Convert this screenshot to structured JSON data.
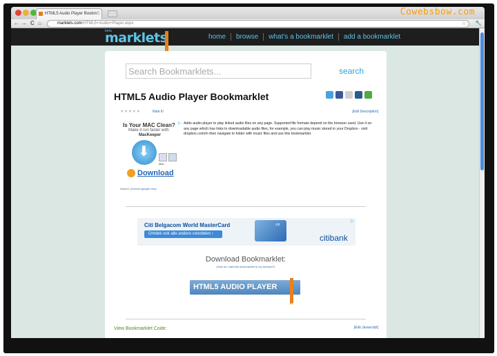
{
  "browser": {
    "tab_title": "HTML5 Audio Player Bookm...",
    "tab_close": "×",
    "url_host": "marklets.com",
    "url_path": "/HTML5+Audio+Player.aspx",
    "back_glyph": "←",
    "forward_glyph": "→",
    "reload_glyph": "C",
    "home_glyph": "⌂",
    "watermark": "Cowebsbow.com",
    "star_glyph": "☆",
    "wrench_glyph": "🔧",
    "icons": [
      "back-icon",
      "forward-icon",
      "reload-icon",
      "home-icon",
      "bookmark-star-icon",
      "wrench-icon"
    ]
  },
  "site": {
    "logo": "marklets",
    "logo_beta": "beta",
    "nav": [
      "home",
      "browse",
      "what's a bookmarklet",
      "add a bookmarklet"
    ],
    "brand_color": "#5ec3e8",
    "ribbon_color": "#e8801c"
  },
  "search": {
    "placeholder": "Search Bookmarklets...",
    "button": "search"
  },
  "bookmarklet": {
    "title": "HTML5 Audio Player Bookmarklet",
    "rating_stars": "★★★★★",
    "rate_it": "Rate it!",
    "edit_description": "[Edit Description]",
    "description": "Adds audio player to play linked audio files on any page. Supported file formats depend on the browser used. Use it on any page which has links to downloadable audio files, for example, you can play music stored in your Dropbox - visit dropbox.com/m then navigate to folder with music files and use this bookmarklet.",
    "source_label": "Source: ",
    "source_link": "(chrome.google.com)",
    "social_icons": [
      "twitter-icon",
      "facebook-icon",
      "delicious-icon",
      "digg-icon",
      "stumbleupon-icon"
    ]
  },
  "ad_mackeeper": {
    "headline": "Is Your MAC Clean?",
    "sub1": "Make it run faster with",
    "sub2": "MacKeeper",
    "download": "Download",
    "mac_label": "Mac",
    "adchoice": "▷"
  },
  "ad_citi": {
    "headline": "Citi Belgacom World MasterCard",
    "cta": "Ontdek ook alle andere voordelen ›",
    "card_label": "citi",
    "logo": "citibank",
    "adchoice": "▷"
  },
  "download": {
    "title": "Download Bookmarklet:",
    "help": "(How do I add this bookmarklet to my browser?)",
    "button": "HTML5 AUDIO PLAYER"
  },
  "code": {
    "view_label": "View Bookmarklet Code:",
    "edit_js": "[Edit Javascript]"
  }
}
